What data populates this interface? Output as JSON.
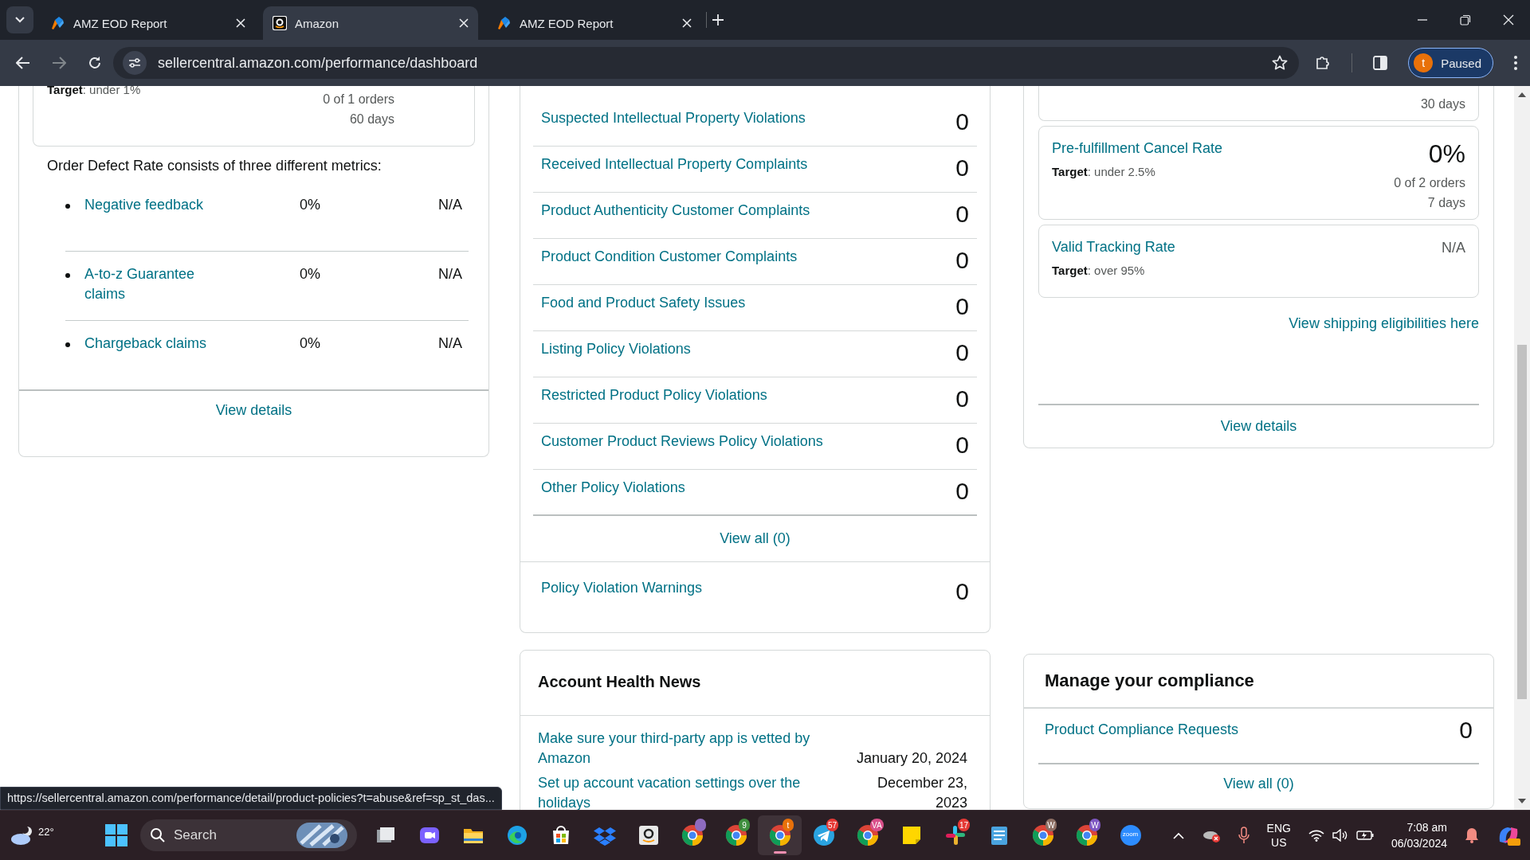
{
  "browser": {
    "tabs": [
      {
        "title": "AMZ EOD Report",
        "kind": "report",
        "selected": false
      },
      {
        "title": "Amazon",
        "kind": "amazon",
        "selected": true
      },
      {
        "title": "AMZ EOD Report",
        "kind": "report",
        "selected": false
      }
    ],
    "address": "sellercentral.amazon.com/performance/dashboard",
    "profile": {
      "initial": "t",
      "label": "Paused"
    }
  },
  "order_defect": {
    "target": "**Target**: under 1%",
    "count": "0 of 1 orders",
    "period": "60 days",
    "intro": "Order Defect Rate consists of three different metrics:",
    "metrics": [
      {
        "name": "Negative feedback",
        "rate": "0%",
        "value": "N/A"
      },
      {
        "name": "A-to-z Guarantee claims",
        "rate": "0%",
        "value": "N/A"
      },
      {
        "name": "Chargeback claims",
        "rate": "0%",
        "value": "N/A"
      }
    ],
    "link": "View details"
  },
  "policy": {
    "rows": [
      {
        "name": "Suspected Intellectual Property Violations",
        "count": "0"
      },
      {
        "name": "Received Intellectual Property Complaints",
        "count": "0"
      },
      {
        "name": "Product Authenticity Customer Complaints",
        "count": "0"
      },
      {
        "name": "Product Condition Customer Complaints",
        "count": "0"
      },
      {
        "name": "Food and Product Safety Issues",
        "count": "0"
      },
      {
        "name": "Listing Policy Violations",
        "count": "0"
      },
      {
        "name": "Restricted Product Policy Violations",
        "count": "0"
      },
      {
        "name": "Customer Product Reviews Policy Violations",
        "count": "0"
      },
      {
        "name": "Other Policy Violations",
        "count": "0"
      }
    ],
    "view_all": "View all (0)",
    "warnings": {
      "name": "Policy Violation Warnings",
      "count": "0"
    }
  },
  "news": {
    "title": "Account Health News",
    "items": [
      {
        "text": "Make sure your third-party app is vetted by Amazon",
        "date": "January 20, 2024"
      },
      {
        "text": "Set up account vacation settings over the holidays",
        "date": "December 23, 2023"
      }
    ]
  },
  "shipping": {
    "period": "30 days",
    "metrics": [
      {
        "name": "Pre-fulfillment Cancel Rate",
        "target": "**Target**: under 2.5%",
        "value": "0%",
        "count": "0 of 2 orders",
        "period": "7 days"
      },
      {
        "name": "Valid Tracking Rate",
        "target": "**Target**: over 95%",
        "value": "N/A"
      }
    ],
    "eligibility_link": "View shipping eligibilities here",
    "link": "View details"
  },
  "compliance": {
    "title": "Manage your compliance",
    "rows": [
      {
        "name": "Product Compliance Requests",
        "count": "0"
      }
    ],
    "view_all": "View all (0)"
  },
  "status_url": "https://sellercentral.amazon.com/performance/detail/product-policies?t=abuse&ref=sp_st_das...",
  "taskbar": {
    "temperature": "22°",
    "search_placeholder": "Search",
    "apps": [
      {
        "kind": "taskview",
        "active": false
      },
      {
        "kind": "meet",
        "active": false
      },
      {
        "kind": "folder",
        "active": false
      },
      {
        "kind": "edge",
        "active": false
      },
      {
        "kind": "store",
        "active": false
      },
      {
        "kind": "dropbox",
        "active": false
      },
      {
        "kind": "amazon",
        "active": false
      },
      {
        "kind": "chrome",
        "color": "#8e6bbf",
        "active": false
      },
      {
        "kind": "chrome",
        "badge": "9",
        "color": "#3f8f3f",
        "active": false
      },
      {
        "kind": "chrome",
        "badge": "t",
        "color": "#e8710a",
        "active": true
      },
      {
        "kind": "telegram",
        "badge": "57",
        "color": "#e53935",
        "active": false
      },
      {
        "kind": "chrome",
        "badge": "VA",
        "color": "#d94f8a",
        "active": false
      },
      {
        "kind": "sticky",
        "active": false
      },
      {
        "kind": "slack",
        "badge": "17",
        "color": "#e53935",
        "active": false
      },
      {
        "kind": "notepad",
        "active": false
      },
      {
        "kind": "chrome",
        "badge": "W",
        "color": "#8d6e63",
        "active": false
      },
      {
        "kind": "chrome",
        "badge": "W",
        "color": "#7e57c2",
        "active": false
      },
      {
        "kind": "zoom",
        "label": "zoom",
        "active": false
      }
    ],
    "language": "ENG",
    "region": "US",
    "time": "7:08 am",
    "date": "06/03/2024"
  }
}
